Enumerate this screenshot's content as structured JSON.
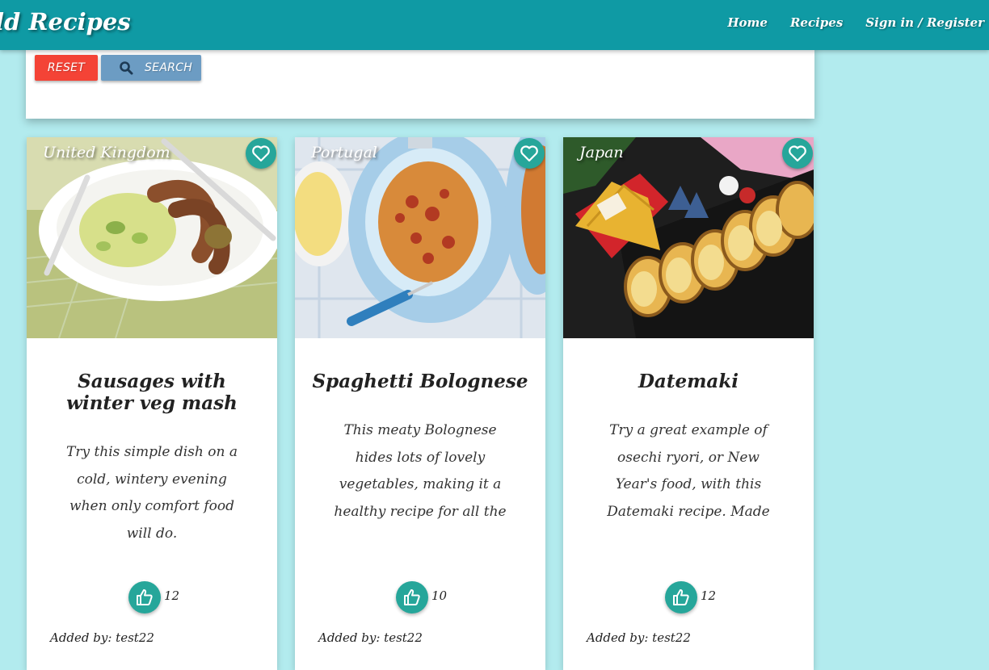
{
  "nav": {
    "brand": "ld Recipes",
    "links": [
      "Home",
      "Recipes",
      "Sign in / Register"
    ]
  },
  "search": {
    "reset_label": "RESET",
    "search_label": "SEARCH"
  },
  "colors": {
    "navbar": "#0f9aa4",
    "background": "#b2ebee",
    "reset_button": "#f44336",
    "search_button": "#6c9cc3",
    "accent_teal": "#26a69a"
  },
  "recipes": [
    {
      "country": "United Kingdom",
      "title": "Sausages with winter veg mash",
      "description": "Try this simple dish on a cold, wintery evening when only comfort food will do.",
      "likes": "12",
      "added_by": "Added by: test22",
      "image": "sausages-with-mash"
    },
    {
      "country": "Portugal",
      "title": "Spaghetti Bolognese",
      "description": "This meaty Bolognese hides lots of lovely vegetables, making it a healthy recipe for all the family.",
      "likes": "10",
      "added_by": "Added by: test22",
      "image": "spaghetti-bolognese"
    },
    {
      "country": "Japan",
      "title": "Datemaki",
      "description": "Try a great example of osechi ryori, or New Year's food, with this Datemaki recipe. Made using eggs and",
      "likes": "12",
      "added_by": "Added by: test22",
      "image": "datemaki-rolls"
    }
  ]
}
